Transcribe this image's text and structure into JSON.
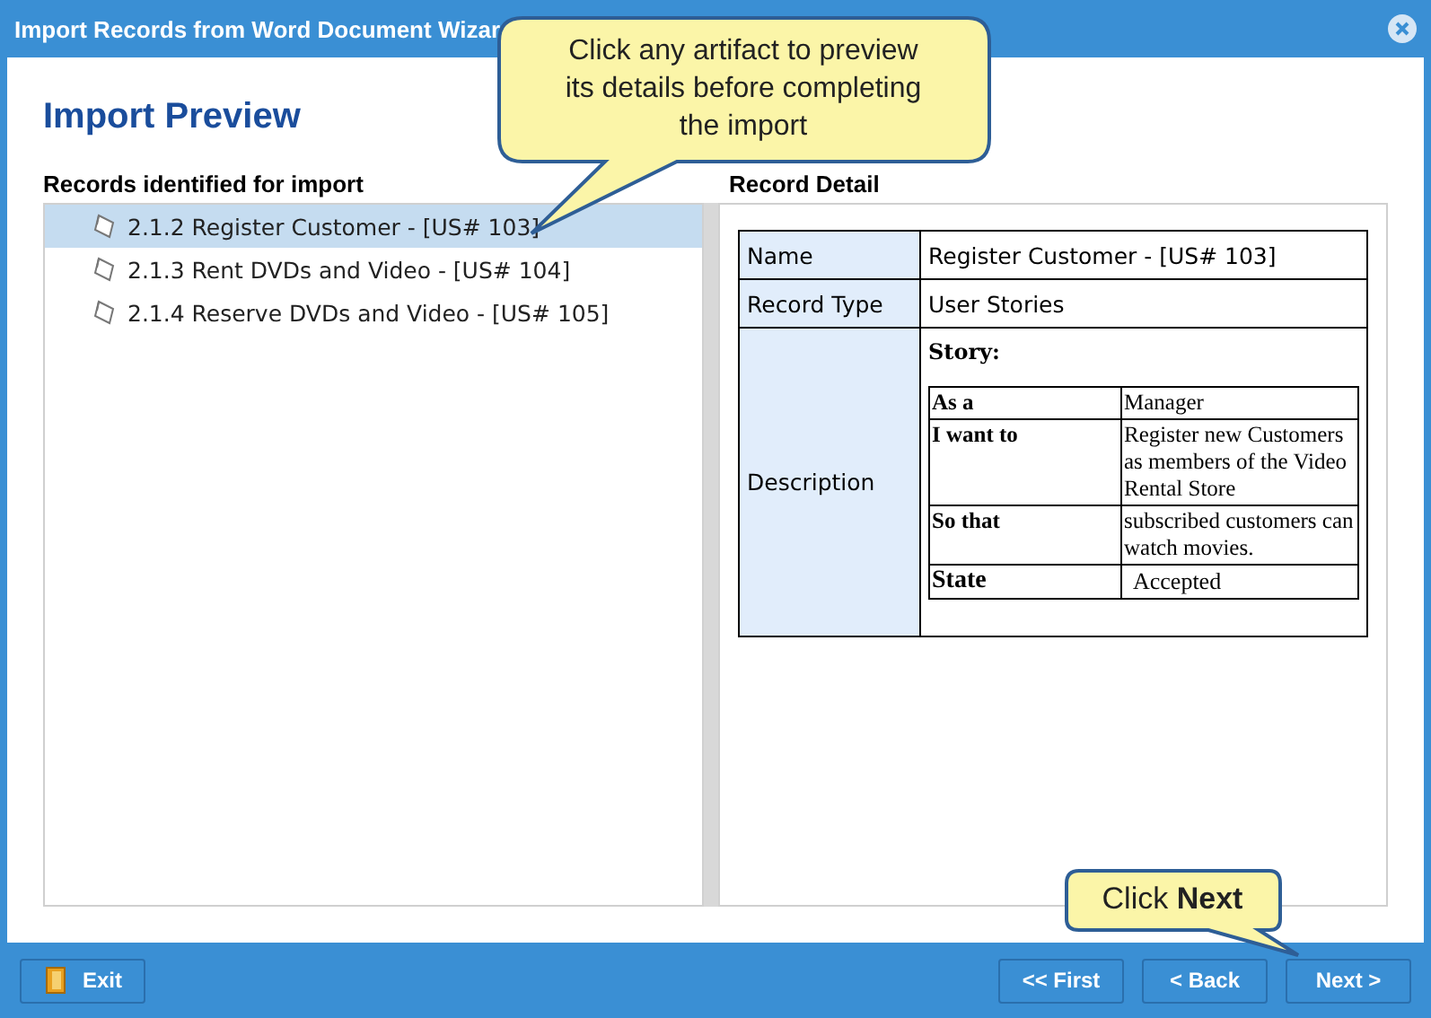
{
  "window": {
    "title": "Import Records from Word Document Wizar"
  },
  "heading": "Import Preview",
  "records": {
    "label": "Records identified for import",
    "items": [
      {
        "text": "2.1.2 Register Customer - [US# 103]",
        "selected": true
      },
      {
        "text": "2.1.3 Rent DVDs and Video - [US# 104]",
        "selected": false
      },
      {
        "text": "2.1.4 Reserve DVDs and Video - [US# 105]",
        "selected": false
      }
    ]
  },
  "detail": {
    "label": "Record Detail",
    "name_label": "Name",
    "name": "Register Customer - [US# 103]",
    "type_label": "Record Type",
    "type": "User Stories",
    "description_label": "Description",
    "story_heading": "Story:",
    "story": [
      {
        "label": "As a",
        "value": "Manager"
      },
      {
        "label": "I want to",
        "value": "Register new Customers as members of the Video Rental Store"
      },
      {
        "label": "So that",
        "value": "subscribed customers can watch movies."
      },
      {
        "label": "State",
        "value": "Accepted"
      }
    ]
  },
  "callouts": [
    "Click any artifact to preview its details before completing the import",
    "Click **Next**"
  ],
  "buttons": {
    "exit": "Exit",
    "first": "<< First",
    "back": "< Back",
    "next": "Next >"
  }
}
